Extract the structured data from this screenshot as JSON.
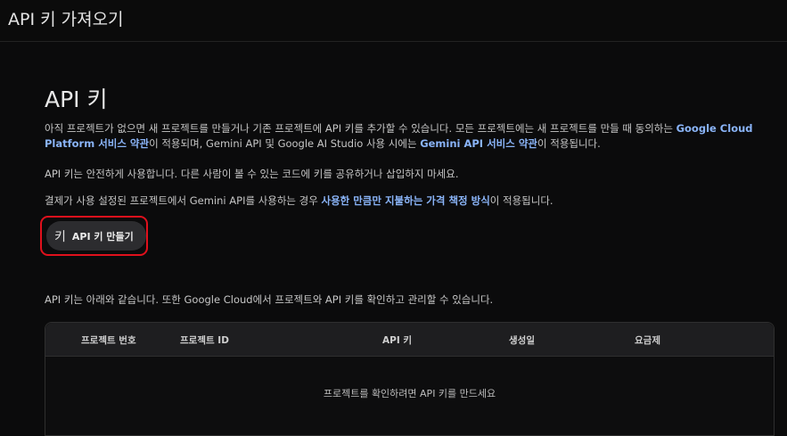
{
  "header": {
    "title": "API 키 가져오기"
  },
  "main": {
    "heading": "API 키",
    "intro": {
      "text_1": "아직 프로젝트가 없으면 새 프로젝트를 만들거나 기존 프로젝트에 API 키를 추가할 수 있습니다. 모든 프로젝트에는 새 프로젝트를 만들 때 동의하는 ",
      "link_1": "Google Cloud Platform 서비스 약관",
      "text_2": "이 적용되며, Gemini API 및 Google AI Studio 사용 시에는 ",
      "link_2": "Gemini API 서비스 약관",
      "text_3": "이 적용됩니다."
    },
    "security_note": "API 키는 안전하게 사용합니다. 다른 사람이 볼 수 있는 코드에 키를 공유하거나 삽입하지 마세요.",
    "billing": {
      "text_1": "결제가 사용 설정된 프로젝트에서 Gemini API를 사용하는 경우 ",
      "link": "사용한 만큼만 지불하는 가격 책정 방식",
      "text_2": "이 적용됩니다."
    },
    "create_button": {
      "icon": "key-icon",
      "icon_glyph": "키",
      "label": "API 키 만들기"
    },
    "list_intro": "API 키는 아래와 같습니다. 또한 Google Cloud에서 프로젝트와 API 키를 확인하고 관리할 수 있습니다."
  },
  "table": {
    "columns": [
      "프로젝트 번호",
      "프로젝트 ID",
      "API 키",
      "생성일",
      "요금제"
    ],
    "empty_message": "프로젝트를 확인하려면 API 키를 만드세요"
  },
  "colors": {
    "background": "#000000",
    "link": "#8ab4f8",
    "highlight": "#e0101c"
  }
}
